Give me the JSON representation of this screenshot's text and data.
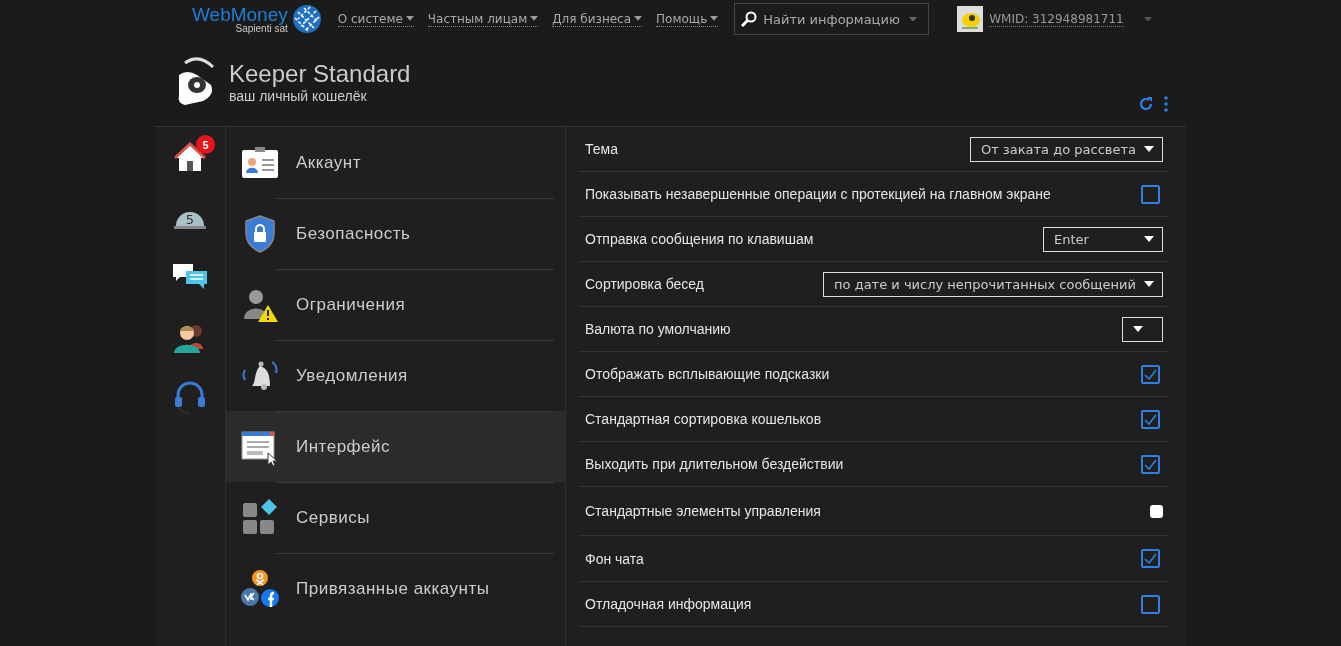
{
  "topbar": {
    "logo": {
      "name": "WebMoney",
      "tagline": "Sapienti sat"
    },
    "menu": [
      {
        "label": "О системе"
      },
      {
        "label": "Частным лицам"
      },
      {
        "label": "Для бизнеса"
      },
      {
        "label": "Помощь"
      }
    ],
    "search": {
      "placeholder": "Найти информацию"
    },
    "account": {
      "wmid": "WMID: 312948981711"
    }
  },
  "header": {
    "title": "Keeper Standard",
    "subtitle": "ваш личный кошелёк"
  },
  "rail": [
    {
      "kind": "home",
      "badge": "5"
    },
    {
      "kind": "coin",
      "label": "5"
    },
    {
      "kind": "chat"
    },
    {
      "kind": "contacts"
    },
    {
      "kind": "headset"
    }
  ],
  "nav": [
    {
      "kind": "account",
      "label": "Аккаунт",
      "selected": false
    },
    {
      "kind": "security",
      "label": "Безопасность",
      "selected": false
    },
    {
      "kind": "limits",
      "label": "Ограничения",
      "selected": false
    },
    {
      "kind": "notifications",
      "label": "Уведомления",
      "selected": false
    },
    {
      "kind": "interface",
      "label": "Интерфейс",
      "selected": true
    },
    {
      "kind": "services",
      "label": "Сервисы",
      "selected": false
    },
    {
      "kind": "linked",
      "label": "Привязанные аккаунты",
      "selected": false
    }
  ],
  "settings": [
    {
      "kind": "select",
      "label": "Тема",
      "value": "От заката до рассвета"
    },
    {
      "kind": "checkbox",
      "label": "Показывать незавершенные операции с протекцией на главном экране",
      "checked": false
    },
    {
      "kind": "select",
      "label": "Отправка сообщения по клавишам",
      "value": "Enter"
    },
    {
      "kind": "select",
      "label": "Сортировка бесед",
      "value": "по дате и числу непрочитанных сообщений"
    },
    {
      "kind": "select",
      "label": "Валюта по умолчанию"
    },
    {
      "kind": "checkbox",
      "label": "Отображать всплывающие подсказки",
      "checked": true
    },
    {
      "kind": "checkbox",
      "label": "Стандартная сортировка кошельков",
      "checked": true
    },
    {
      "kind": "checkbox",
      "label": "Выходить при длительном бездействии",
      "checked": true
    },
    {
      "kind": "native",
      "label": "Стандартные элементы управления",
      "checked": false
    },
    {
      "kind": "checkbox",
      "label": "Фон чата",
      "checked": true
    },
    {
      "kind": "checkbox",
      "label": "Отладочная информация",
      "checked": false
    }
  ]
}
